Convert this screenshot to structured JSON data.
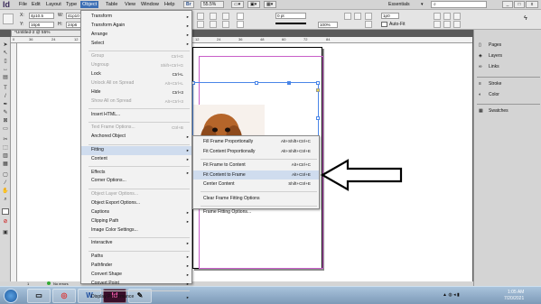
{
  "app": {
    "logo": "Id"
  },
  "menubar": {
    "items": [
      "File",
      "Edit",
      "Layout",
      "Type",
      "Object",
      "Table",
      "View",
      "Window",
      "Help"
    ],
    "active": "Object",
    "bridge": "Br",
    "zoom": "55.5%",
    "workspace": "Essentials",
    "search_placeholder": "",
    "win_minimize": "_",
    "win_restore": "□",
    "win_close": "x"
  },
  "control": {
    "x_label": "X:",
    "x_value": "4p10.5",
    "y_label": "Y:",
    "y_value": "16p6",
    "w_label": "W:",
    "w_value": "41p10",
    "h_label": "H:",
    "h_value": "24p6",
    "stroke_value": "0 pt",
    "opacity_value": "100%",
    "gutter_value": "1p0",
    "autofit_label": "Auto-Fit"
  },
  "document": {
    "tab_title": "*Untitled-2 @ 55%",
    "ruler_ticks": [
      "0",
      "36",
      "24",
      "12",
      "12",
      "24",
      "36",
      "48",
      "60",
      "72",
      "84"
    ]
  },
  "panels": [
    {
      "icon": "pages-icon",
      "label": "Pages"
    },
    {
      "icon": "layers-icon",
      "label": "Layers"
    },
    {
      "icon": "links-icon",
      "label": "Links"
    },
    {
      "icon": "stroke-icon",
      "label": "Stroke"
    },
    {
      "icon": "color-icon",
      "label": "Color"
    },
    {
      "icon": "swatches-icon",
      "label": "Swatches"
    }
  ],
  "status": {
    "page": "1",
    "errors": "No errors"
  },
  "object_menu": [
    {
      "label": "Transform",
      "sub": true
    },
    {
      "label": "Transform Again",
      "sub": true
    },
    {
      "label": "Arrange",
      "sub": true
    },
    {
      "label": "Select",
      "sub": true
    },
    {
      "sep": true
    },
    {
      "label": "Group",
      "shortcut": "Ctrl+G",
      "disabled": true
    },
    {
      "label": "Ungroup",
      "shortcut": "Shift+Ctrl+G",
      "disabled": true
    },
    {
      "label": "Lock",
      "shortcut": "Ctrl+L"
    },
    {
      "label": "Unlock All on Spread",
      "shortcut": "Alt+Ctrl+L",
      "disabled": true
    },
    {
      "label": "Hide",
      "shortcut": "Ctrl+3"
    },
    {
      "label": "Show All on Spread",
      "shortcut": "Alt+Ctrl+3",
      "disabled": true
    },
    {
      "sep": true
    },
    {
      "label": "Insert HTML..."
    },
    {
      "sep": true
    },
    {
      "label": "Text Frame Options...",
      "shortcut": "Ctrl+B",
      "disabled": true
    },
    {
      "label": "Anchored Object",
      "sub": true
    },
    {
      "sep": true
    },
    {
      "label": "Fitting",
      "sub": true,
      "highlight": true
    },
    {
      "label": "Content",
      "sub": true
    },
    {
      "sep": true
    },
    {
      "label": "Effects",
      "sub": true
    },
    {
      "label": "Corner Options..."
    },
    {
      "sep": true
    },
    {
      "label": "Object Layer Options...",
      "disabled": true
    },
    {
      "label": "Object Export Options..."
    },
    {
      "label": "Captions",
      "sub": true
    },
    {
      "label": "Clipping Path",
      "sub": true
    },
    {
      "label": "Image Color Settings..."
    },
    {
      "sep": true
    },
    {
      "label": "Interactive",
      "sub": true
    },
    {
      "sep": true
    },
    {
      "label": "Paths",
      "sub": true
    },
    {
      "label": "Pathfinder",
      "sub": true
    },
    {
      "label": "Convert Shape",
      "sub": true
    },
    {
      "label": "Convert Point",
      "sub": true
    },
    {
      "sep": true
    },
    {
      "label": "Display Performance",
      "sub": true
    }
  ],
  "fitting_menu": [
    {
      "label": "Fill Frame Proportionally",
      "shortcut": "Alt+Shift+Ctrl+C"
    },
    {
      "label": "Fit Content Proportionally",
      "shortcut": "Alt+Shift+Ctrl+E"
    },
    {
      "sep": true
    },
    {
      "label": "Fit Frame to Content",
      "shortcut": "Alt+Ctrl+C"
    },
    {
      "label": "Fit Content to Frame",
      "shortcut": "Alt+Ctrl+E",
      "highlight": true
    },
    {
      "label": "Center Content",
      "shortcut": "Shift+Ctrl+E"
    },
    {
      "sep": true
    },
    {
      "label": "Clear Frame Fitting Options"
    },
    {
      "sep": true
    },
    {
      "label": "Frame Fitting Options..."
    }
  ],
  "taskbar": {
    "clock_time": "1:05 AM",
    "clock_date": "7/20/2021",
    "apps": [
      "start-orb",
      "explorer",
      "chrome",
      "word",
      "indesign",
      "paint"
    ]
  },
  "colors": {
    "accent": "#3c6fb4",
    "highlight": "#cfdcee",
    "margin": "#c85ec8",
    "frame": "#4a86e8"
  }
}
